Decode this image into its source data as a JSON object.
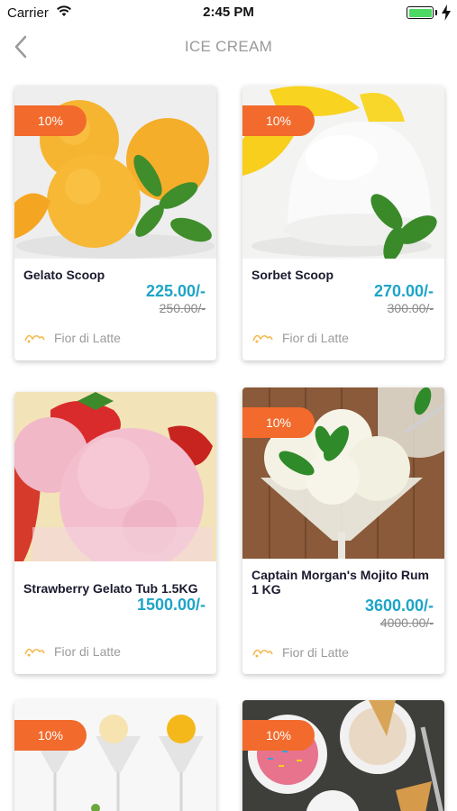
{
  "status_bar": {
    "carrier": "Carrier",
    "time": "2:45 PM",
    "battery_level": 1.0
  },
  "nav": {
    "title": "ICE CREAM",
    "back_icon": "chevron-left-icon"
  },
  "colors": {
    "badge": "#f26a2c",
    "price": "#1ea4c8",
    "battery": "#4cd964"
  },
  "products": [
    {
      "name": "Gelato Scoop",
      "discount": "10%",
      "price": "225.00/-",
      "old_price": "250.00/-",
      "brand": "Fior di Latte",
      "image": "orange-gelato-scoops"
    },
    {
      "name": "Sorbet Scoop",
      "discount": "10%",
      "price": "270.00/-",
      "old_price": "300.00/-",
      "brand": "Fior di Latte",
      "image": "lemon-sorbet-scoop"
    },
    {
      "name": "Strawberry Gelato Tub 1.5KG",
      "discount": "",
      "price": "1500.00/-",
      "old_price": "",
      "brand": "Fior di Latte",
      "image": "strawberry-gelato-tub"
    },
    {
      "name": "Captain Morgan's Mojito Rum 1 KG",
      "discount": "10%",
      "price": "3600.00/-",
      "old_price": "4000.00/-",
      "brand": "Fior di Latte",
      "image": "mojito-ice-cream-glass"
    },
    {
      "name": "",
      "discount": "10%",
      "price": "",
      "old_price": "",
      "brand": "",
      "image": "sorbet-glasses"
    },
    {
      "name": "",
      "discount": "10%",
      "price": "",
      "old_price": "",
      "brand": "",
      "image": "sprinkles-bowls"
    }
  ]
}
